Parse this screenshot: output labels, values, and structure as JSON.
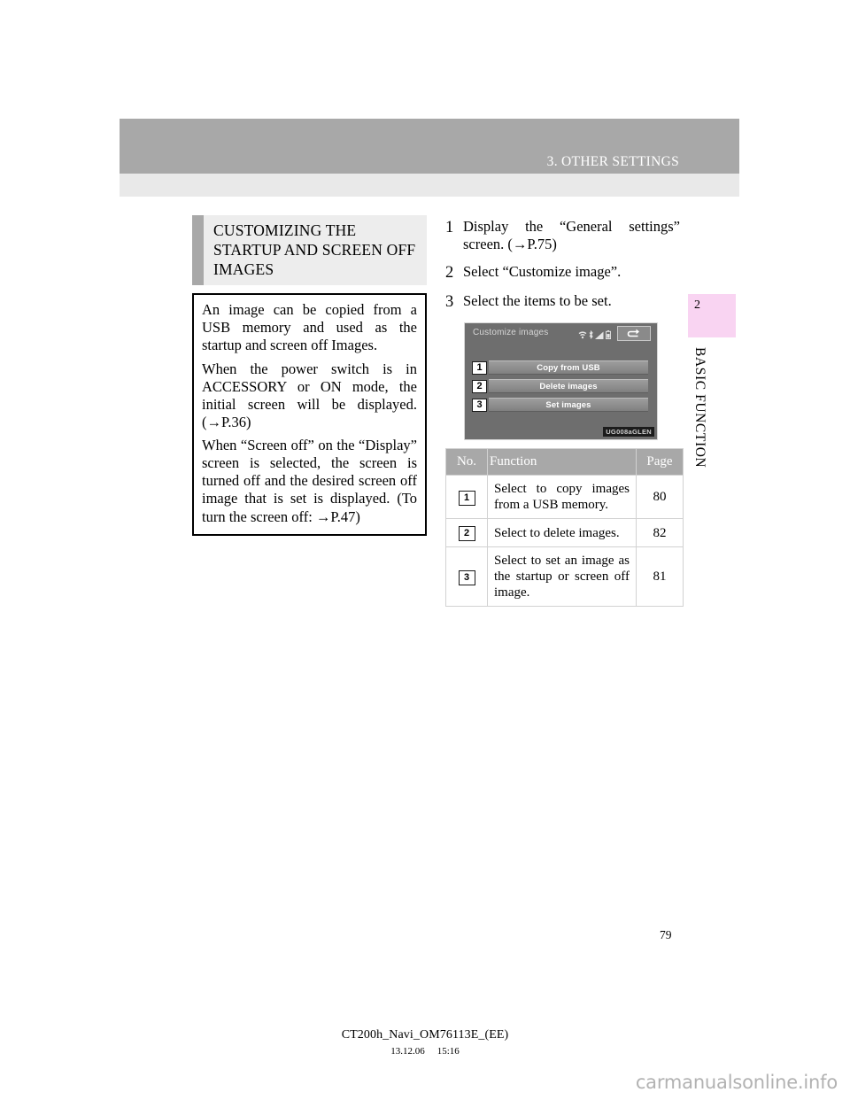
{
  "header": {
    "chapter_title": "3. OTHER SETTINGS"
  },
  "section": {
    "title": "CUSTOMIZING THE STARTUP AND SCREEN OFF IMAGES",
    "paragraphs": [
      "An image can be copied from a USB memory and used as the startup and screen off Images.",
      "When the power switch is in ACCESSORY or ON mode, the initial screen will be displayed. (→P.36)",
      "When “Screen off” on the “Display” screen is selected, the screen is turned off and the desired screen off image that is set is displayed. (To turn the screen off: →P.47)"
    ]
  },
  "steps": [
    {
      "num": "1",
      "text": "Display the “General settings” screen. (→P.75)"
    },
    {
      "num": "2",
      "text": "Select “Customize image”."
    },
    {
      "num": "3",
      "text": "Select the items to be set."
    }
  ],
  "nav_screen": {
    "title": "Customize images",
    "back_icon": "back-arrow-icon",
    "status_icons": [
      "wifi-icon",
      "bluetooth-icon",
      "signal-bars-icon",
      "battery-icon"
    ],
    "buttons": [
      {
        "badge": "1",
        "label": "Copy from USB"
      },
      {
        "badge": "2",
        "label": "Delete images"
      },
      {
        "badge": "3",
        "label": "Set images"
      }
    ],
    "figure_code": "UG008aGLEN"
  },
  "table": {
    "headers": {
      "no": "No.",
      "function": "Function",
      "page": "Page"
    },
    "rows": [
      {
        "no": "1",
        "function": "Select to copy images from a USB memory.",
        "page": "80"
      },
      {
        "no": "2",
        "function": "Select to delete images.",
        "page": "82"
      },
      {
        "no": "3",
        "function": "Select to set an image as the startup or screen off image.",
        "page": "81"
      }
    ]
  },
  "side_tab": {
    "number": "2",
    "label": "BASIC FUNCTION"
  },
  "footer": {
    "page_number": "79",
    "doc_id": "CT200h_Navi_OM76113E_(EE)",
    "date": "13.12.06",
    "time": "15:16",
    "watermark": "carmanualsonline.info"
  }
}
